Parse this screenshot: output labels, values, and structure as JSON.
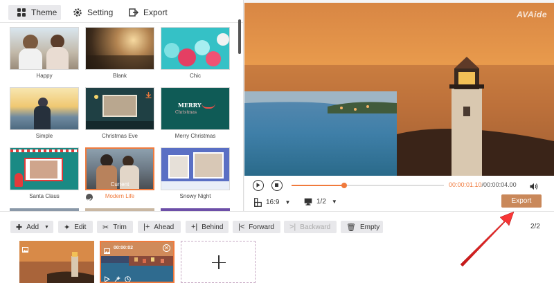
{
  "tabs": [
    {
      "label": "Theme",
      "icon": "grid-icon",
      "active": true
    },
    {
      "label": "Setting",
      "icon": "gear-icon",
      "active": false
    },
    {
      "label": "Export",
      "icon": "export-icon",
      "active": false
    }
  ],
  "themes": [
    {
      "label": "Happy"
    },
    {
      "label": "Blank"
    },
    {
      "label": "Chic"
    },
    {
      "label": "Simple"
    },
    {
      "label": "Christmas Eve"
    },
    {
      "label": "Merry Christmas"
    },
    {
      "label": "Santa Claus"
    },
    {
      "label": "Modern Life",
      "selected": true,
      "badge": "Current"
    },
    {
      "label": "Snowy Night"
    }
  ],
  "preview": {
    "brand": "AVAide"
  },
  "player": {
    "time_current": "00:00:01.10",
    "time_total": "/00:00:04.00",
    "progress": 0.345,
    "aspect_ratio": "16:9",
    "screen": "1/2",
    "export_label": "Export"
  },
  "toolbar": {
    "add": "Add",
    "edit": "Edit",
    "trim": "Trim",
    "ahead": "Ahead",
    "behind": "Behind",
    "forward": "Forward",
    "backward": "Backward",
    "empty": "Empty",
    "page_count": "2/2"
  },
  "timeline": {
    "clip2_time": "00:00:02"
  },
  "colors": {
    "accent": "#f07a3c",
    "export_button": "#c9885a",
    "arrow": "#e02020"
  }
}
